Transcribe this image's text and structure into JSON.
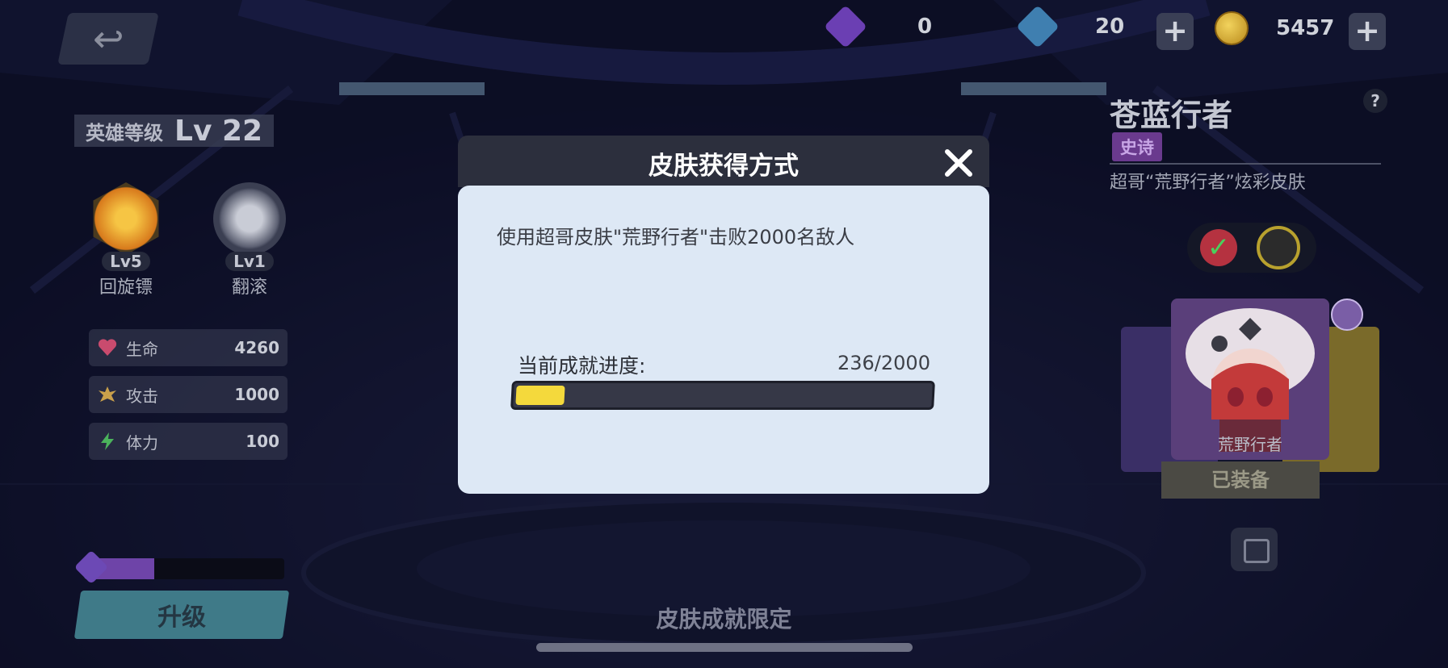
{
  "top_bar": {
    "purple_gems": "0",
    "blue_gems": "20",
    "coins": "5457",
    "plus_label": "+",
    "back_icon": "back-arrow-icon"
  },
  "hero": {
    "level_label": "英雄等级",
    "level_value": "Lv 22",
    "skills": [
      {
        "level": "Lv5",
        "name": "回旋镖"
      },
      {
        "level": "Lv1",
        "name": "翻滚"
      }
    ],
    "stats": [
      {
        "label": "生命",
        "value": "4260",
        "icon": "heart-icon",
        "color": "#c94b6e"
      },
      {
        "label": "攻击",
        "value": "1000",
        "icon": "attack-icon",
        "color": "#c9a04b"
      },
      {
        "label": "体力",
        "value": "100",
        "icon": "lightning-icon",
        "color": "#4bb35c"
      }
    ],
    "xp_fraction": 0.35,
    "upgrade_label": "升级"
  },
  "skin": {
    "title": "苍蓝行者",
    "rarity": "史诗",
    "description": "超哥“荒野行者”炫彩皮肤",
    "card_name": "荒野行者",
    "equipped_label": "已装备",
    "help_label": "?"
  },
  "bottom": {
    "lock_text": "皮肤成就限定"
  },
  "modal": {
    "title": "皮肤获得方式",
    "close_icon": "close-icon",
    "condition": "使用超哥皮肤\"荒野行者\"击败2000名敌人",
    "progress_label": "当前成就进度:",
    "progress_text": "236/2000",
    "progress_current": 236,
    "progress_total": 2000,
    "accent_color": "#f4d93c"
  }
}
